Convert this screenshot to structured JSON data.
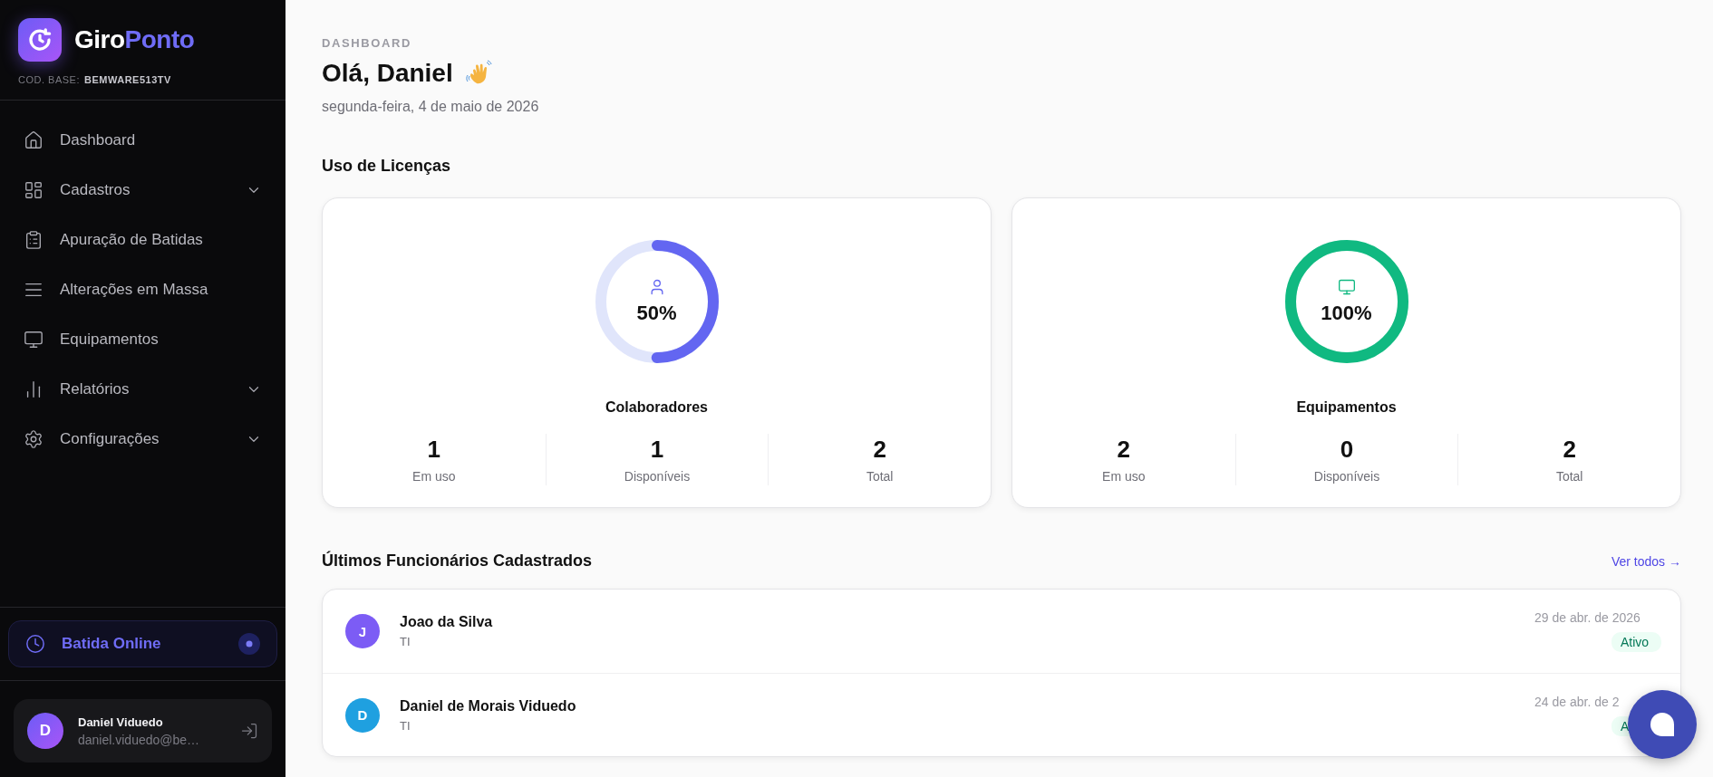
{
  "sidebar": {
    "brand": {
      "first": "Giro",
      "second": "Ponto"
    },
    "base_label": "COD. BASE:",
    "base_code": "BEMWARE513TV",
    "items": [
      {
        "label": "Dashboard",
        "kind": "link"
      },
      {
        "label": "Cadastros",
        "kind": "group",
        "expanded": false
      },
      {
        "label": "Apuração de Batidas",
        "kind": "link"
      },
      {
        "label": "Alterações em Massa",
        "kind": "link"
      },
      {
        "label": "Equipamentos",
        "kind": "link"
      },
      {
        "label": "Relatórios",
        "kind": "group",
        "expanded": false
      },
      {
        "label": "Configurações",
        "kind": "group",
        "expanded": false
      }
    ],
    "online_button": {
      "label": "Batida Online"
    },
    "user": {
      "initial": "D",
      "name": "Daniel Viduedo",
      "email": "daniel.viduedo@be…"
    }
  },
  "header": {
    "breadcrumb": "DASHBOARD",
    "greeting": "Olá, Daniel",
    "date": "segunda-feira, 4 de maio de 2026"
  },
  "licenses": {
    "title": "Uso de Licenças",
    "cards": [
      {
        "kind": "people",
        "title": "Colaboradores",
        "percent": "50%",
        "level": 0.5,
        "color": "#6366f1",
        "stats": [
          {
            "value": "1",
            "label": "Em uso"
          },
          {
            "value": "1",
            "label": "Disponíveis"
          },
          {
            "value": "2",
            "label": "Total"
          }
        ]
      },
      {
        "kind": "devices",
        "title": "Equipamentos",
        "percent": "100%",
        "level": 1,
        "color": "#10b981",
        "stats": [
          {
            "value": "2",
            "label": "Em uso"
          },
          {
            "value": "0",
            "label": "Disponíveis"
          },
          {
            "value": "2",
            "label": "Total"
          }
        ]
      }
    ]
  },
  "employees": {
    "title": "Últimos Funcionários Cadastrados",
    "link": "Ver todos →",
    "rows": [
      {
        "initial": "J",
        "name": "Joao da Silva",
        "department": "TI",
        "date": "29 de abr. de 2026",
        "status": "Ativo",
        "color": "#7c5cf5"
      },
      {
        "initial": "D",
        "name": "Daniel de Morais Viduedo",
        "department": "TI",
        "date": "24 de abr. de 2",
        "status": "A",
        "color": "#1fa0e0"
      }
    ]
  }
}
